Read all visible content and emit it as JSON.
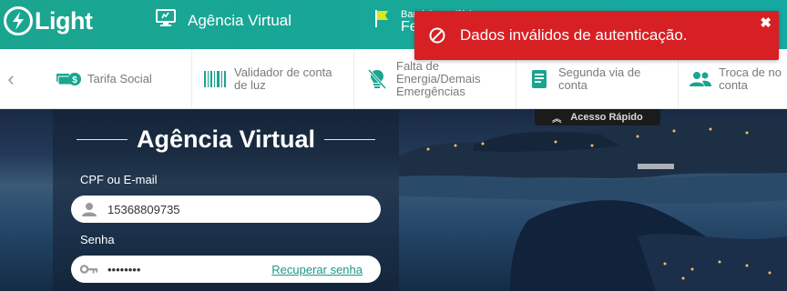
{
  "header": {
    "logo_text": "Light",
    "agencia_label": "Agência Virtual",
    "flag_line1": "Bandeira tarifária",
    "flag_line2": "Fe"
  },
  "services": {
    "items": [
      {
        "label": "Tarifa Social",
        "icon": "money-icon"
      },
      {
        "label": "Validador de conta de luz",
        "icon": "barcode-icon"
      },
      {
        "label": "Falta de Energia/Demais Emergências",
        "icon": "bulb-off-icon"
      },
      {
        "label": "Segunda via de conta",
        "icon": "document-icon"
      },
      {
        "label": "Troca de no conta",
        "icon": "users-icon"
      }
    ]
  },
  "acesso_rapido": "Acesso Rápido",
  "login": {
    "title": "Agência Virtual",
    "cpf_label": "CPF ou E-mail",
    "cpf_value": "15368809735",
    "senha_label": "Senha",
    "senha_value": "••••••••",
    "recover_link": "Recuperar senha"
  },
  "toast": {
    "message": "Dados inválidos de autenticação.",
    "close": "✖"
  },
  "colors": {
    "brand": "#1aa58f",
    "error": "#d72024",
    "link": "#1a9a86"
  }
}
